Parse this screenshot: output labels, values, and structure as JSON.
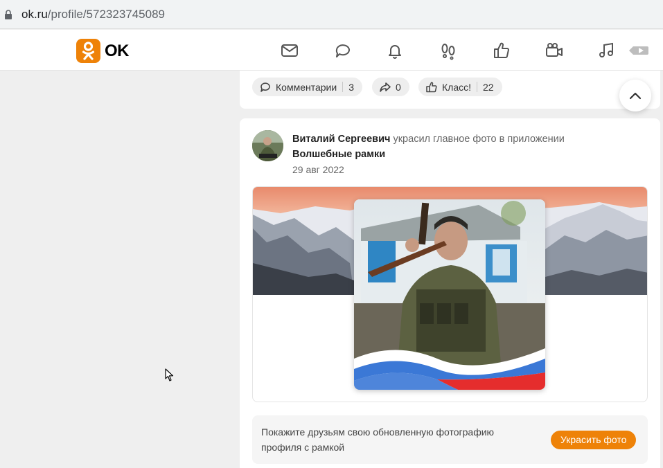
{
  "browser": {
    "url_host": "ok.ru",
    "url_path": "/profile/572323745089"
  },
  "header": {
    "logo_text": "OK",
    "nav_icons": [
      "mail-icon",
      "discussions-icon",
      "notifications-icon",
      "guests-icon",
      "likes-icon",
      "video-icon",
      "music-icon",
      "video-tab-icon"
    ]
  },
  "prev_post": {
    "comments_label": "Комментарии",
    "comments_count": "3",
    "shares_count": "0",
    "likes_label": "Класс!",
    "likes_count": "22"
  },
  "post": {
    "author": "Виталий Сергеевич",
    "action": " украсил главное фото в приложении",
    "app_name": "Волшебные рамки",
    "date": "29 авг 2022"
  },
  "cta": {
    "text": "Покажите друзьям свою обновленную фотографию профиля с рамкой",
    "button_label": "Украсить фото"
  },
  "colors": {
    "brand": "#ee8208",
    "background": "#efefef"
  }
}
